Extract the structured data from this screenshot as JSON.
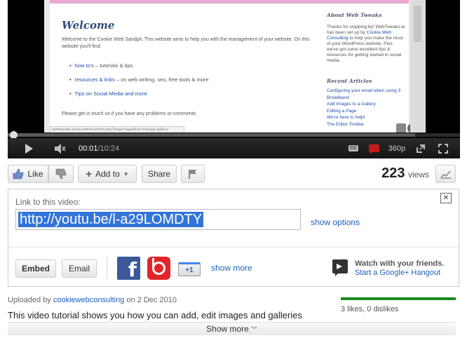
{
  "video_frame": {
    "welcome": "Welcome",
    "intro": "Welcome to the Cookie Web Sandpit. This website aims to help you with the management of your website. On this website you'll find:",
    "bullets": [
      {
        "link": "how to's",
        "rest": " – tutorials & tips"
      },
      {
        "link": "resources & links",
        "rest": " – on web writing, seo, free tools & more"
      },
      {
        "link": "Tips on Social Media and more",
        "rest": ""
      }
    ],
    "help_line": "Please get in touch us if you have any problems or comments.",
    "status_url": "webtweaks.ie/wp-admin/admin.php?page=nggallery-manage-gallery",
    "about_heading": "About Web Tweaks",
    "about_text_1": "Thanks for stopping by! WebTweaks.ie has been set up by ",
    "about_link": "Cookie Web Consulting",
    "about_text_2": " to help you make the most of your WordPress website. Plus we've got some excellent tips & resources for getting started in social media.",
    "recent_heading": "Recent Articles",
    "recent_articles": [
      "Configuring your email when using 3 Broadband",
      "Add Images to a Gallery",
      "Editing a Page",
      "We're here to help!",
      "The Editor Toolbar"
    ]
  },
  "player": {
    "current_time": "00:01",
    "separator": " / ",
    "total_time": "10:24",
    "quality": "360p",
    "cc_label": "CC",
    "played_fraction": 0.002,
    "loaded_fraction": 0.9
  },
  "actions": {
    "like": "Like",
    "add_to": "Add to",
    "share": "Share",
    "views_count": "223",
    "views_label": "views"
  },
  "share_panel": {
    "link_label": "Link to this video:",
    "url": "http://youtu.be/l-a29LOMDTY",
    "show_options": "show options",
    "embed": "Embed",
    "email": "Email",
    "facebook_glyph": "f",
    "gplus_label": "+1",
    "show_more": "show more",
    "watch_friends": "Watch with your friends.",
    "start_hangout": "Start a Google+ Hangout",
    "close_glyph": "✕"
  },
  "details": {
    "uploaded_by": "Uploaded by ",
    "uploader": "cookiewebconsulting",
    "upload_date": " on 2 Dec 2010",
    "description": "This video tutorial shows you how you can add, edit images and galleries",
    "likes_text": "3 likes, 0 dislikes",
    "like_fraction": 1.0,
    "show_more": "Show more"
  }
}
